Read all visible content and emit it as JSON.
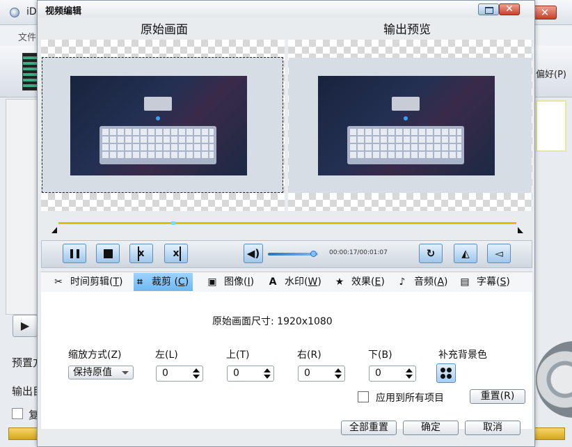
{
  "background": {
    "app_title": "iDe",
    "menu_file": "文件(",
    "preferences": "偏好(P)",
    "preset_label": "预置方",
    "output_label": "输出目",
    "checkbox_label": "复"
  },
  "dialog": {
    "title": "视频编辑",
    "close_glyph": "✕",
    "original_title": "原始画面",
    "output_title": "输出预览"
  },
  "playback": {
    "time": "00:00:17/00:01:07",
    "progress_fraction": 0.25,
    "volume_fraction": 0.9
  },
  "tabs": [
    {
      "icon": "scissors-icon",
      "glyph": "✂",
      "label": "时间剪辑(",
      "key": "T",
      "suffix": ")"
    },
    {
      "icon": "crop-icon",
      "glyph": "⌗",
      "label": "裁剪 (",
      "key": "C",
      "suffix": ")",
      "active": true
    },
    {
      "icon": "image-icon",
      "glyph": "▣",
      "label": "图像(",
      "key": "I",
      "suffix": ")"
    },
    {
      "icon": "watermark-icon",
      "glyph": "A",
      "label": "水印(",
      "key": "W",
      "suffix": ")"
    },
    {
      "icon": "star-icon",
      "glyph": "★",
      "label": "效果(",
      "key": "E",
      "suffix": ")"
    },
    {
      "icon": "music-note-icon",
      "glyph": "♪",
      "label": "音频(",
      "key": "A",
      "suffix": ")"
    },
    {
      "icon": "subtitle-icon",
      "glyph": "▤",
      "label": "字幕(",
      "key": "S",
      "suffix": ")"
    }
  ],
  "crop": {
    "original_size": "原始画面尺寸: 1920x1080",
    "scale_label": "缩放方式(Z)",
    "scale_value": "保持原值",
    "left_label": "左(L)",
    "left_value": "0",
    "top_label": "上(T)",
    "top_value": "0",
    "right_label": "右(R)",
    "right_value": "0",
    "bottom_label": "下(B)",
    "bottom_value": "0",
    "fill_bg_label": "补充背景色",
    "apply_all_label": "应用到所有项目",
    "reset_label": "重置(R)"
  },
  "footer": {
    "reset_all": "全部重置",
    "ok": "确定",
    "cancel": "取消"
  }
}
